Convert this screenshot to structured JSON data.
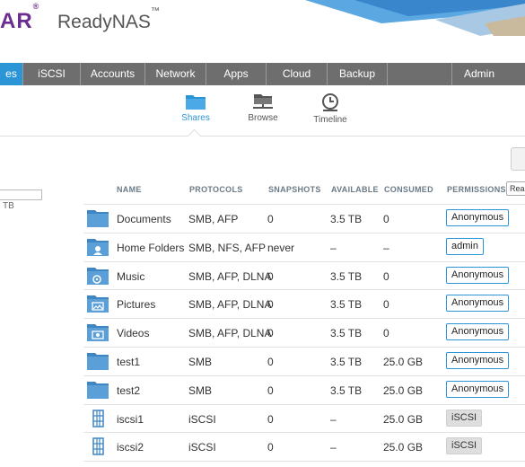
{
  "header": {
    "brand": "AR",
    "brand_mark": "®",
    "product": "ReadyNAS",
    "product_mark": "™"
  },
  "nav": {
    "items": [
      "es",
      "iSCSI",
      "Accounts",
      "Network",
      "Apps",
      "Cloud",
      "Backup",
      "",
      "Admin Passwo"
    ]
  },
  "subtabs": [
    {
      "label": "Shares",
      "icon": "folder-icon"
    },
    {
      "label": "Browse",
      "icon": "browse-icon"
    },
    {
      "label": "Timeline",
      "icon": "clock-icon"
    }
  ],
  "left": {
    "tb": "TB"
  },
  "table": {
    "headers": [
      "NAME",
      "PROTOCOLS",
      "SNAPSHOTS",
      "AVAILABLE",
      "CONSUMED",
      "PERMISSIONS"
    ],
    "read_button": "Rea",
    "rows": [
      {
        "name": "Documents",
        "protocols": "SMB, AFP",
        "snapshots": "0",
        "available": "3.5 TB",
        "consumed": "0",
        "permission": "Anonymous",
        "icon": "folder-icon"
      },
      {
        "name": "Home Folders",
        "protocols": "SMB, NFS, AFP",
        "snapshots": "never",
        "available": "–",
        "consumed": "–",
        "permission": "admin",
        "icon": "home-folder-icon"
      },
      {
        "name": "Music",
        "protocols": "SMB, AFP, DLNA",
        "snapshots": "0",
        "available": "3.5 TB",
        "consumed": "0",
        "permission": "Anonymous",
        "icon": "music-folder-icon"
      },
      {
        "name": "Pictures",
        "protocols": "SMB, AFP, DLNA",
        "snapshots": "0",
        "available": "3.5 TB",
        "consumed": "0",
        "permission": "Anonymous",
        "icon": "pictures-folder-icon"
      },
      {
        "name": "Videos",
        "protocols": "SMB, AFP, DLNA",
        "snapshots": "0",
        "available": "3.5 TB",
        "consumed": "0",
        "permission": "Anonymous",
        "icon": "videos-folder-icon"
      },
      {
        "name": "test1",
        "protocols": "SMB",
        "snapshots": "0",
        "available": "3.5 TB",
        "consumed": "25.0 GB",
        "permission": "Anonymous",
        "icon": "folder-icon"
      },
      {
        "name": "test2",
        "protocols": "SMB",
        "snapshots": "0",
        "available": "3.5 TB",
        "consumed": "25.0 GB",
        "permission": "Anonymous",
        "icon": "folder-icon"
      },
      {
        "name": "iscsi1",
        "protocols": "iSCSI",
        "snapshots": "0",
        "available": "–",
        "consumed": "25.0 GB",
        "permission": "iSCSI",
        "icon": "iscsi-lun-icon"
      },
      {
        "name": "iscsi2",
        "protocols": "iSCSI",
        "snapshots": "0",
        "available": "–",
        "consumed": "25.0 GB",
        "permission": "iSCSI",
        "icon": "iscsi-lun-icon"
      }
    ]
  },
  "colors": {
    "accent": "#2b95d6",
    "nav_bg": "#6e6e6e",
    "brand": "#6b2e8f",
    "folder": "#5b9fd8"
  }
}
